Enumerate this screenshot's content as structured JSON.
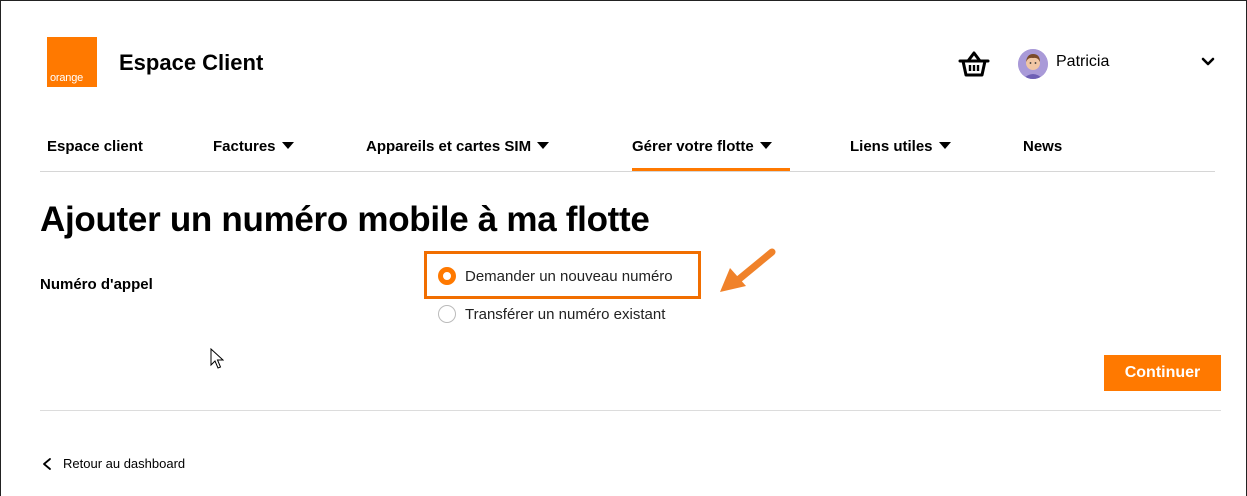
{
  "header": {
    "logo_text": "orange",
    "app_title": "Espace Client",
    "basket_icon": "shopping-basket-icon",
    "user": {
      "name": "Patricia",
      "avatar_icon": "user-avatar-icon",
      "menu_icon": "chevron-down-icon"
    }
  },
  "nav": {
    "items": [
      {
        "label": "Espace client",
        "dropdown": false
      },
      {
        "label": "Factures",
        "dropdown": true
      },
      {
        "label": "Appareils et cartes SIM",
        "dropdown": true
      },
      {
        "label": "Gérer votre flotte",
        "dropdown": true,
        "active": true
      },
      {
        "label": "Liens utiles",
        "dropdown": true
      },
      {
        "label": "News",
        "dropdown": false
      }
    ]
  },
  "page": {
    "title": "Ajouter un numéro mobile à ma flotte",
    "field_label": "Numéro d'appel",
    "options": [
      {
        "label": "Demander un nouveau numéro",
        "selected": true
      },
      {
        "label": "Transférer un numéro existant",
        "selected": false
      }
    ],
    "continue_label": "Continuer",
    "back_label": "Retour au dashboard"
  },
  "colors": {
    "brand": "#ff7900",
    "highlight": "#f16e00"
  }
}
